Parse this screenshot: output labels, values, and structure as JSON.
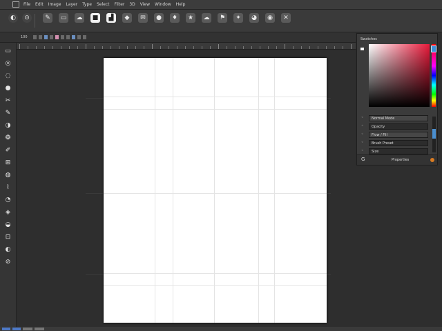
{
  "menubar": {
    "items": [
      "File",
      "Edit",
      "Image",
      "Layer",
      "Type",
      "Select",
      "Filter",
      "3D",
      "View",
      "Window",
      "Help"
    ]
  },
  "options": {
    "left_controls": [
      "◐",
      "⊙"
    ],
    "tools": [
      {
        "icon": "pen-tool-icon",
        "glyph": "✎"
      },
      {
        "icon": "eraser-icon",
        "glyph": "▭"
      },
      {
        "icon": "smudge-icon",
        "glyph": "☁"
      },
      {
        "icon": "square-icon",
        "glyph": "■"
      },
      {
        "icon": "bucket-icon",
        "glyph": "▟"
      },
      {
        "icon": "shield-icon",
        "glyph": "◆"
      },
      {
        "icon": "mail-icon",
        "glyph": "✉"
      },
      {
        "icon": "drop-icon",
        "glyph": "●"
      },
      {
        "icon": "brush-icon",
        "glyph": "♦"
      },
      {
        "icon": "star-icon",
        "glyph": "★"
      },
      {
        "icon": "cloud-icon",
        "glyph": "☁"
      },
      {
        "icon": "flag-icon",
        "glyph": "⚑"
      },
      {
        "icon": "spark-icon",
        "glyph": "✦"
      },
      {
        "icon": "globe-icon",
        "glyph": "◕"
      },
      {
        "icon": "ink-icon",
        "glyph": "◉"
      },
      {
        "icon": "close-box-icon",
        "glyph": "✕"
      }
    ]
  },
  "secondary_bar": {
    "doc_label": "100"
  },
  "toolbox": {
    "tools": [
      "▭",
      "◎",
      "◌",
      "●",
      "✂",
      "✎",
      "◑",
      "❂",
      "✐",
      "⊞",
      "◍",
      "⌇",
      "◔",
      "◈",
      "◒",
      "⊡",
      "◐",
      "⊘"
    ]
  },
  "color_panel": {
    "title": "Swatches",
    "rows": [
      {
        "label": "Normal  Mode",
        "icon": "link-icon",
        "highlighted": true
      },
      {
        "label": "Opacity",
        "icon": "adjust-icon",
        "highlighted": false
      },
      {
        "label": "Flow / Fill",
        "icon": "layers-icon",
        "highlighted": true
      },
      {
        "label": "Brush Preset",
        "icon": "brush-icon",
        "highlighted": false
      },
      {
        "label": "Size",
        "icon": "size-icon",
        "highlighted": false
      }
    ],
    "footer_label": "Properties",
    "footer_glyph": "G",
    "hue_gradient_colors": [
      "#ff0000",
      "#ff00ff",
      "#0000ff",
      "#00ffff",
      "#00ff00",
      "#ffff00"
    ],
    "selected_color": "#e8193a"
  },
  "colors": {
    "background": "#2b2b2b",
    "panel": "#3b3b3b",
    "accent": "#3d8fd6",
    "artboard": "#ffffff"
  }
}
